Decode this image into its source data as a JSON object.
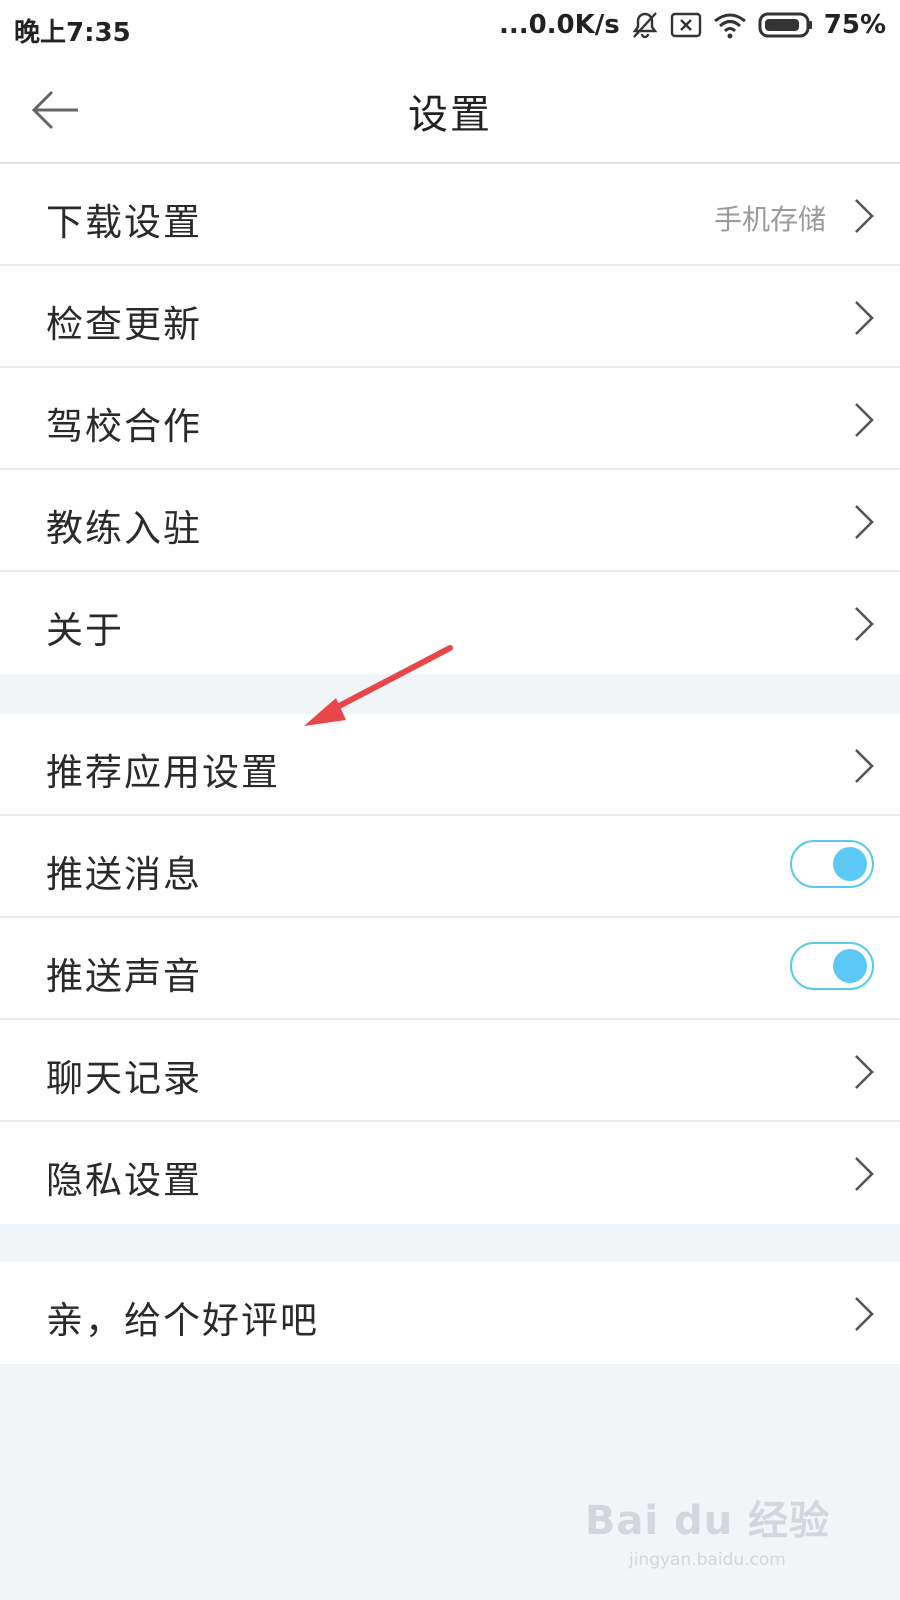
{
  "status_bar": {
    "time": "晚上7:35",
    "network_speed": "...0.0K/s",
    "battery_percent": "75%",
    "icons": [
      "mute-bell-icon",
      "sim-x-icon",
      "wifi-icon",
      "battery-icon"
    ]
  },
  "app_bar": {
    "title": "设置",
    "back_icon": "arrow-left-icon"
  },
  "groups": [
    {
      "items": [
        {
          "label": "下载设置",
          "value": "手机存储",
          "control": "chevron"
        },
        {
          "label": "检查更新",
          "control": "chevron"
        },
        {
          "label": "驾校合作",
          "control": "chevron"
        },
        {
          "label": "教练入驻",
          "control": "chevron"
        },
        {
          "label": "关于",
          "control": "chevron"
        }
      ]
    },
    {
      "items": [
        {
          "label": "推荐应用设置",
          "control": "chevron"
        },
        {
          "label": "推送消息",
          "control": "toggle",
          "on": true
        },
        {
          "label": "推送声音",
          "control": "toggle",
          "on": true
        },
        {
          "label": "聊天记录",
          "control": "chevron"
        },
        {
          "label": "隐私设置",
          "control": "chevron"
        }
      ]
    },
    {
      "items": [
        {
          "label": "亲，给个好评吧",
          "control": "chevron"
        }
      ]
    }
  ],
  "annotation": {
    "type": "red-arrow-icon",
    "color": "#e8474a"
  },
  "watermark": {
    "logo": "Bai du 经验",
    "url": "jingyan.baidu.com"
  },
  "colors": {
    "accent": "#5bc8f5",
    "background": "#f1f5f8",
    "divider": "#ececec"
  }
}
